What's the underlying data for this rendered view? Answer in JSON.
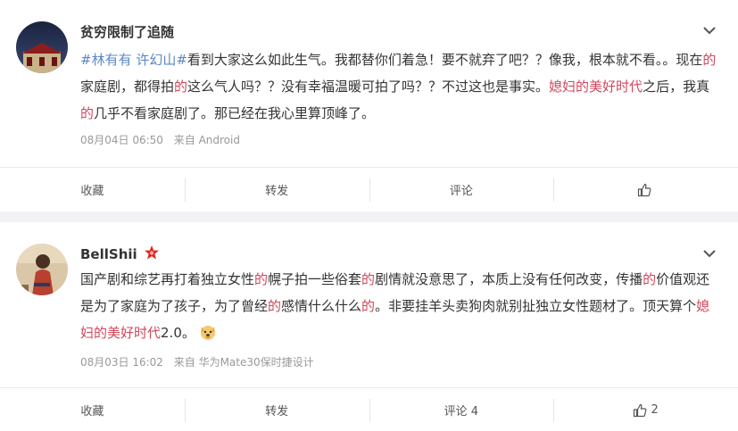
{
  "posts": [
    {
      "username": "贫穷限制了追随",
      "text_parts": [
        {
          "t": "#林有有 许幻山#",
          "c": "blue"
        },
        {
          "t": "看到大家这么如此生气。我都替你们着急！要不就弃了吧？？像我，根本就不看。。现在",
          "c": ""
        },
        {
          "t": "的",
          "c": "red"
        },
        {
          "t": "家庭剧，都得拍",
          "c": ""
        },
        {
          "t": "的",
          "c": "red"
        },
        {
          "t": "这么气人吗？？没有幸福温暖可拍了吗？？不过这也是事实。",
          "c": ""
        },
        {
          "t": "媳妇的美好时代",
          "c": "red"
        },
        {
          "t": "之后，我真",
          "c": ""
        },
        {
          "t": "的",
          "c": "red"
        },
        {
          "t": "几乎不看家庭剧了。那已经在我心里算顶峰了。",
          "c": ""
        }
      ],
      "date": "08月04日 06:50",
      "source": "来自 Android",
      "actions": {
        "collect": "收藏",
        "repost": "转发",
        "comment": "评论",
        "like_count": ""
      }
    },
    {
      "username": "BellShii",
      "text_parts": [
        {
          "t": "国产剧和综艺再打着独立女性",
          "c": ""
        },
        {
          "t": "的",
          "c": "red"
        },
        {
          "t": "幌子拍一些俗套",
          "c": ""
        },
        {
          "t": "的",
          "c": "red"
        },
        {
          "t": "剧情就没意思了，本质上没有任何改变，传播",
          "c": ""
        },
        {
          "t": "的",
          "c": "red"
        },
        {
          "t": "价值观还是为了家庭为了孩子，为了曾经",
          "c": ""
        },
        {
          "t": "的",
          "c": "red"
        },
        {
          "t": "感情什么什么",
          "c": ""
        },
        {
          "t": "的",
          "c": "red"
        },
        {
          "t": "。非要挂羊头卖狗肉就别扯独立女性题材了。顶天算个",
          "c": ""
        },
        {
          "t": "媳妇的美好时代",
          "c": "red"
        },
        {
          "t": "2.0。",
          "c": ""
        }
      ],
      "date": "08月03日 16:02",
      "source": "来自 华为Mate30保时捷设计",
      "actions": {
        "collect": "收藏",
        "repost": "转发",
        "comment": "评论 4",
        "like_count": "2"
      }
    }
  ],
  "icons": {
    "chevron": "chevron-down-icon",
    "like": "thumbs-up-icon",
    "vip": "vip-star-icon",
    "emoji": "dog-emoji-icon"
  },
  "colors": {
    "keyword_red": "#d0475c",
    "topic_blue": "#5b87c7",
    "vip_red": "#e2241a"
  }
}
